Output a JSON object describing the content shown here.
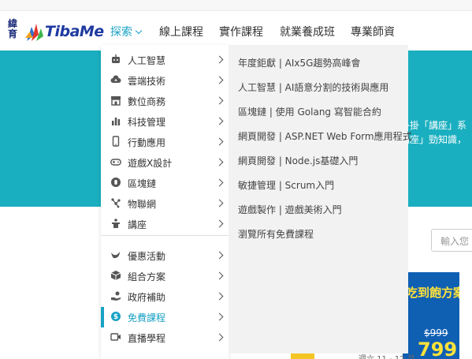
{
  "logo": {
    "mark_line1": "緯",
    "mark_line2": "育",
    "text": "TibaMe",
    "colors": {
      "mark": "#1a2b7a",
      "text": "#1f3aa0",
      "flame_red": "#e2382c",
      "flame_green": "#3cb44b",
      "flame_blue": "#2d6fd2"
    }
  },
  "nav": {
    "items": [
      {
        "label": "探索",
        "active": true
      },
      {
        "label": "線上課程",
        "active": false
      },
      {
        "label": "實作課程",
        "active": false
      },
      {
        "label": "就業養成班",
        "active": false
      },
      {
        "label": "專業師資",
        "active": false
      }
    ],
    "accent": "#17a2c4"
  },
  "hero": {
    "line1": "外掛「講座」系",
    "line2": "講座」勁知識，",
    "bg": "#1aafc0"
  },
  "search": {
    "placeholder": "輸入您"
  },
  "promo": {
    "title": "吃到飽方案",
    "old_price": "$999",
    "new_price": "799"
  },
  "card": {
    "date": "週六 11 - 12 月"
  },
  "menu": {
    "categories": [
      {
        "label": "人工智慧",
        "icon": "robot-icon"
      },
      {
        "label": "雲端技術",
        "icon": "cloud-upload-icon"
      },
      {
        "label": "數位商務",
        "icon": "store-icon"
      },
      {
        "label": "科技管理",
        "icon": "bar-chart-icon"
      },
      {
        "label": "行動應用",
        "icon": "mobile-phone-icon"
      },
      {
        "label": "遊戲X設計",
        "icon": "gamepad-icon"
      },
      {
        "label": "區塊鏈",
        "icon": "coin-icon"
      },
      {
        "label": "物聯網",
        "icon": "network-nodes-icon"
      },
      {
        "label": "講座",
        "icon": "podium-icon"
      }
    ],
    "extras": [
      {
        "label": "優惠活動",
        "icon": "bird-icon",
        "active": false
      },
      {
        "label": "組合方案",
        "icon": "box-icon",
        "active": false
      },
      {
        "label": "政府補助",
        "icon": "hand-coin-icon",
        "active": false
      },
      {
        "label": "免費課程",
        "icon": "dollar-circle-icon",
        "active": true
      },
      {
        "label": "直播學程",
        "icon": "video-icon",
        "active": false
      }
    ],
    "submenu": [
      "年度鉅獻 | AIx5G趨勢高峰會",
      "人工智慧 | AI語意分割的技術與應用",
      "區塊鏈 | 使用 Golang 寫智能合約",
      "網頁開發 | ASP.NET Web Form應用程式",
      "網頁開發 | Node.js基礎入門",
      "敏捷管理 | Scrum入門",
      "遊戲製作 | 遊戲美術入門",
      "瀏覽所有免費課程"
    ]
  }
}
